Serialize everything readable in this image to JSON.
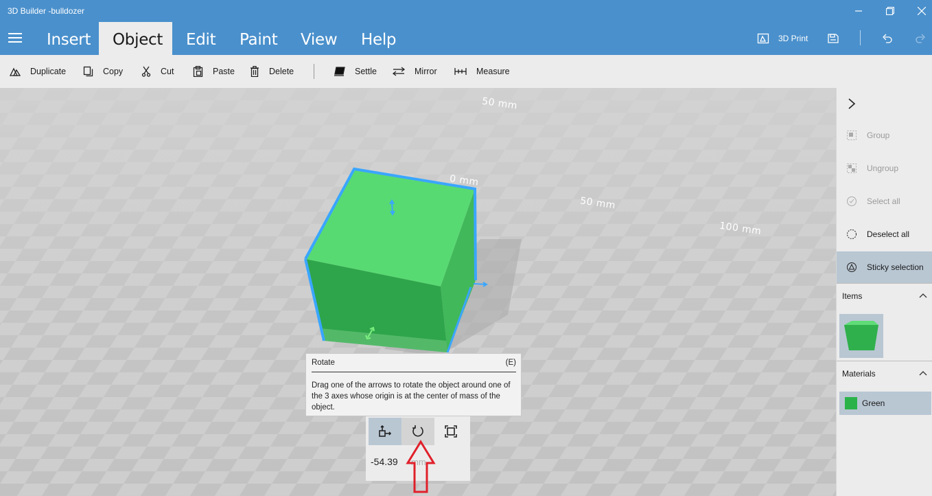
{
  "window": {
    "title": "3D Builder -bulldozer",
    "controls": [
      "minimize-icon",
      "restore-icon",
      "close-icon"
    ]
  },
  "menu": {
    "tabs": [
      {
        "label": "Insert",
        "active": false
      },
      {
        "label": "Object",
        "active": true
      },
      {
        "label": "Edit",
        "active": false
      },
      {
        "label": "Paint",
        "active": false
      },
      {
        "label": "View",
        "active": false
      },
      {
        "label": "Help",
        "active": false
      }
    ],
    "print_label": "3D Print",
    "icons": [
      "hamburger-icon",
      "print-3d-icon",
      "save-icon",
      "undo-icon",
      "redo-icon"
    ]
  },
  "toolbar": {
    "items": [
      {
        "label": "Duplicate",
        "icon": "duplicate-icon"
      },
      {
        "label": "Copy",
        "icon": "copy-icon"
      },
      {
        "label": "Cut",
        "icon": "scissors-icon"
      },
      {
        "label": "Paste",
        "icon": "paste-icon"
      },
      {
        "label": "Delete",
        "icon": "trash-icon"
      },
      {
        "label": "Settle",
        "icon": "settle-icon"
      },
      {
        "label": "Mirror",
        "icon": "mirror-icon"
      },
      {
        "label": "Measure",
        "icon": "measure-icon"
      }
    ]
  },
  "canvas": {
    "ruler_labels": [
      "50 mm",
      "0 mm",
      "50 mm",
      "100 mm"
    ],
    "object_color": "#3ecf5c",
    "selection_color": "#3aa6ff"
  },
  "tooltip": {
    "title": "Rotate",
    "shortcut": "(E)",
    "description": "Drag one of the arrows to rotate the object around one of the 3 axes whose origin is at the center of mass of the object."
  },
  "transform_panel": {
    "modes": [
      {
        "icon": "move-icon",
        "active": true
      },
      {
        "icon": "rotate-icon",
        "active": false
      },
      {
        "icon": "scale-icon",
        "active": false
      }
    ],
    "value": "-54.39",
    "unit": "mm"
  },
  "side_panel": {
    "expand_icon": "chevron-right-icon",
    "actions": [
      {
        "label": "Group",
        "icon": "group-icon",
        "enabled": false
      },
      {
        "label": "Ungroup",
        "icon": "ungroup-icon",
        "enabled": false
      },
      {
        "label": "Select all",
        "icon": "select-all-icon",
        "enabled": false
      },
      {
        "label": "Deselect all",
        "icon": "deselect-all-icon",
        "enabled": true
      },
      {
        "label": "Sticky selection",
        "icon": "sticky-selection-icon",
        "enabled": true,
        "selected": true
      }
    ],
    "items_header": "Items",
    "materials_header": "Materials",
    "materials": [
      {
        "name": "Green",
        "color": "#2bb34a"
      }
    ]
  },
  "annotation": {
    "arrow_color": "#e0202a"
  }
}
